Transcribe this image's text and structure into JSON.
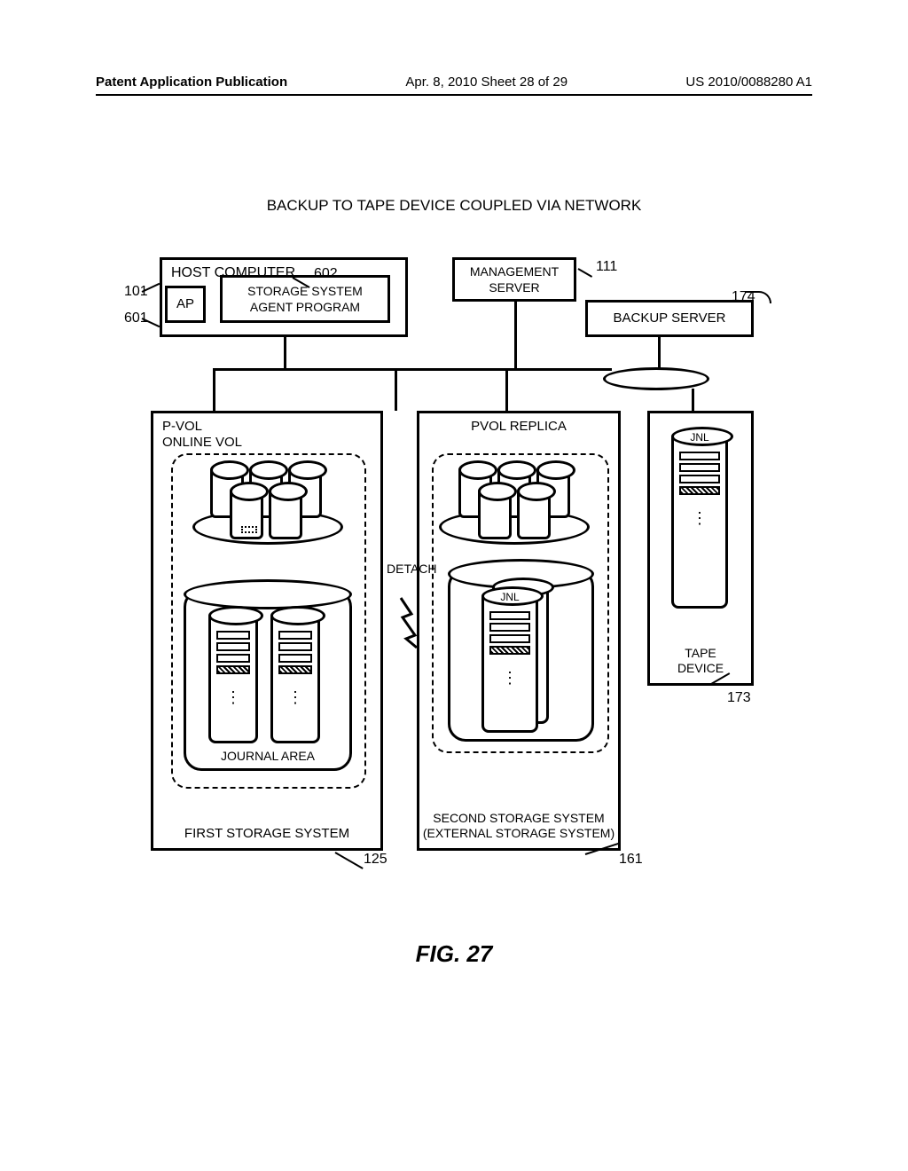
{
  "header": {
    "left": "Patent Application Publication",
    "center": "Apr. 8, 2010   Sheet 28 of 29",
    "right": "US 2010/0088280 A1"
  },
  "caption": "BACKUP TO TAPE DEVICE COUPLED VIA NETWORK",
  "figure_label": "FIG. 27",
  "refs": {
    "r101": "101",
    "r601": "601",
    "r602": "602",
    "r111": "111",
    "r174": "174",
    "r173": "173",
    "r125": "125",
    "r161": "161"
  },
  "host": {
    "title": "HOST COMPUTER",
    "ap": "AP",
    "sap_line1": "STORAGE SYSTEM",
    "sap_line2": "AGENT PROGRAM"
  },
  "mgmt": {
    "line1": "MANAGEMENT",
    "line2": "SERVER"
  },
  "backup_server": "BACKUP SERVER",
  "fss": {
    "title_line1": "P-VOL",
    "title_line2": "ONLINE VOL",
    "journal_area": "JOURNAL AREA",
    "bottom": "FIRST STORAGE SYSTEM"
  },
  "sss": {
    "title": "PVOL REPLICA",
    "bottom_line1": "SECOND STORAGE SYSTEM",
    "bottom_line2": "(EXTERNAL STORAGE SYSTEM)"
  },
  "tape": {
    "label_line1": "TAPE",
    "label_line2": "DEVICE"
  },
  "jnl": "JNL",
  "detach": "DETACH",
  "vdots": "⋮"
}
